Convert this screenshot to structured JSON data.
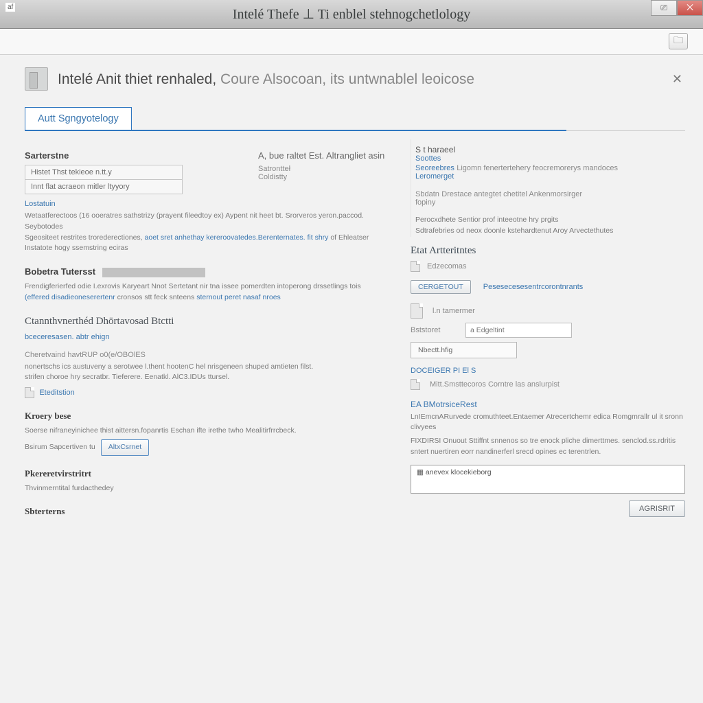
{
  "titlebar": {
    "small": "af",
    "title": "Intelé Thefe ⊥ Ti enblel stehnogchetlology"
  },
  "toolbar": {
    "settings_icon": "⚙"
  },
  "status": {
    "strong": "Intelé Anit thiet renhaled, ",
    "rest": "Coure Alsocoan, its untwnablel leoicose",
    "close": "✕"
  },
  "tabs": {
    "item0": "Autt Sgngyotelogy"
  },
  "upper_right": {
    "heading": "S t haraeel",
    "link1": "Soottes",
    "link2": "Seoreebres",
    "desc1": "Ligomn fenertertehery feocremorerys mandoces",
    "link3": "Leromerget",
    "sub1": "Sbdatn",
    "desc2": "Drestace antegtet chetitel Ankenmorsirger",
    "sub2": "fopiny",
    "para1": "Perocxdhete Sentior prof inteeotne hry prgits",
    "para2": "Sdtrafebries od neox doonle kstehardtenut Aroy Arvectethutes"
  },
  "left": {
    "sec1_h": "Sarterstne",
    "box1": "Histet Thst tekieoe n.tt.y",
    "box2": "Innt flat acraeon mitler ltyyory",
    "link1": "Lostatuin",
    "para1a": "Wetaatferectoos (16 ooeratres sathstrizy (prayent fileedtoy ex) Aypent nit heet bt. Srorveros yeron.paccod. Seybotodes",
    "para1b": "Sgeositeet restrites trorederectiones, ",
    "para1_link": "aoet sret anhethay kereroovatedes.Berenternates. fit shry",
    "para1c": " of Ehleatser Instatote hogy ssemstring eciras",
    "sec2_h": "Bobetra Tutersst",
    "para2a": "Frendigferierfed odie I.exrovis Karyeart Nnot Sertetant nir tna issee pomerdten intoperong drssetlings tois",
    "para2_link": "(effered disadieoneserertenr",
    "para2b": " cronsos stt feck snteens ",
    "para2_link2": "sternout peret nasaf nroes",
    "sec3_h": "Ctannthvnerthéd Dhörtavosad Btctti",
    "link3": "bceceresasen. abtr ehign",
    "sec3_sub": "Cheretvaind havtRUP o0(e/OBOlES",
    "para3a": "nonertschs ics austuveny a serotwee l.thent hootenC hel nrisgeneen shuped amtieten filst.",
    "para3b": "strifen choroe hry secratbr. Tieferere. Eenatkl. AlC3.IDUs ttursel.",
    "btn_edit": "Eteditstion",
    "sec4_h": "Kroery bese",
    "para4": "Soerse nifraneyinichee thist aittersn.fopanrtis Eschan ifte irethe twho Mealitirfrrcbeck.",
    "para4b": "Bsirum Sapcertiven tu",
    "btn_box": "AltxCsrnet",
    "sec5_h": "Pkereretvirstritrt",
    "para5": "Thvinmerntital furdacthedey",
    "sec6_h": "Sbterterns"
  },
  "mid": {
    "h1": "A, bue raltet Est. Altrangliet asin",
    "l1": "Satrontteł",
    "l2": "Coldistty",
    "right_h": "Etat Artteritntes",
    "icon_lbl": "Edzecomas",
    "btn1": "CERGETOUT",
    "link1": "Pesesecesesentrcorontnrants",
    "lbl2": "l.n tamermer",
    "lbl3": "Bststoret",
    "field_ph": "a Edgeltint",
    "field2": "Nbectt.hfig",
    "h2": "DOCEIGER PI El S",
    "doc_lbl": "Mitt.Smsttecoros Corntre las anslurpist",
    "h3": "EA BMotrsiceRest",
    "p1": "LnIEmcnARurvede cromuthteet.Entaemer Atrecertchemr edica Romgmrallr ul it sronn clivyees",
    "p2": "FIXDIRSI Onuout Sttiffnt snnenos so tre enock pliche dimerttmes. senclod.ss.rdritis sntert nuertiren eorr nandinerferl srecd opines ec terentrlen.",
    "long_lbl": "▦ anevex klocekieborg",
    "footer_btn": "AGRISRIT"
  }
}
